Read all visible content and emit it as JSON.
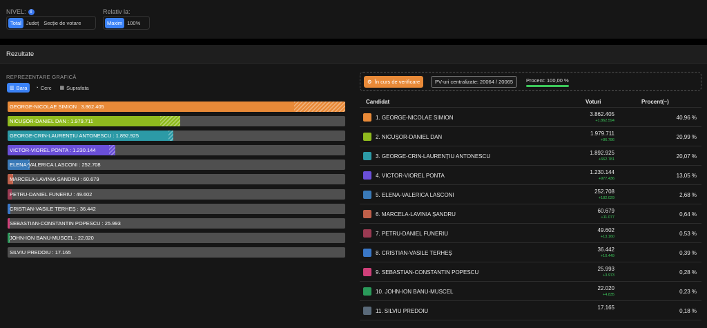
{
  "filters": {
    "nivel_label": "NIVEL:",
    "nivel_options": [
      "Total",
      "Județ",
      "Secție de votare"
    ],
    "nivel_active": 0,
    "relativ_label": "Relativ la:",
    "relativ_options": [
      "Maxim",
      "100%"
    ],
    "relativ_active": 0
  },
  "results_title": "Rezultate",
  "grafica": {
    "label": "REPREZENTARE GRAFICĂ",
    "tabs": [
      "Bara",
      "Cerc",
      "Suprafata"
    ],
    "active": 0
  },
  "status": {
    "verification": "În curs de verificare",
    "pv_text": "PV-uri centralizate: 20064 / 20065",
    "procent_text": "Procent: 100,00 %",
    "procent_value": 100
  },
  "table_headers": {
    "candidat": "Candidat",
    "voturi": "Voturi",
    "procent": "Procent(~)"
  },
  "candidates": [
    {
      "num": "1.",
      "name": "GEORGE-NICOLAE SIMION",
      "bar_label": "GEORGE-NICOLAE SIMION : 3.862.405",
      "votes": "3.862.405",
      "delta": "+1.862.594",
      "pct": "40,96 %",
      "color": "#e98a38",
      "bar_value": 1.0,
      "hatch_from": 0.848
    },
    {
      "num": "2.",
      "name": "NICUȘOR-DANIEL DAN",
      "bar_label": "NICUȘOR-DANIEL DAN : 1.979.711",
      "votes": "1.979.711",
      "delta": "+86.786",
      "pct": "20,99 %",
      "color": "#8fba1e",
      "bar_value": 0.512,
      "hatch_from": 0.451
    },
    {
      "num": "3.",
      "name": "GEORGE-CRIN-LAURENȚIU ANTONESCU",
      "bar_label": "GEORGE-CRIN-LAURENȚIU ANTONESCU : 1.892.925",
      "votes": "1.892.925",
      "delta": "+662.781",
      "pct": "20,07 %",
      "color": "#2c9aa6",
      "bar_value": 0.49,
      "hatch_from": 0.476
    },
    {
      "num": "4.",
      "name": "VICTOR-VIOREL PONTA",
      "bar_label": "VICTOR-VIOREL PONTA : 1.230.144",
      "votes": "1.230.144",
      "delta": "+977.436",
      "pct": "13,05 %",
      "color": "#6a4fd8",
      "bar_value": 0.318,
      "hatch_from": 0.301
    },
    {
      "num": "5.",
      "name": "ELENA-VALERICA LASCONI",
      "bar_label": "ELENA-VALERICA LASCONI : 252.708",
      "votes": "252.708",
      "delta": "+182.029",
      "pct": "2,68 %",
      "color": "#3a7ab8",
      "bar_value": 0.065,
      "hatch_from": 0.061
    },
    {
      "num": "6.",
      "name": "MARCELA-LAVINIA ȘANDRU",
      "bar_label": "MARCELA-LAVINIA ȘANDRU : 60.679",
      "votes": "60.679",
      "delta": "+11.077",
      "pct": "0,64 %",
      "color": "#c0604a",
      "bar_value": 0.016,
      "hatch_from": 0.014
    },
    {
      "num": "7.",
      "name": "PETRU-DANIEL FUNERIU",
      "bar_label": "PETRU-DANIEL FUNERIU : 49.602",
      "votes": "49.602",
      "delta": "+13.160",
      "pct": "0,53 %",
      "color": "#9a3a52",
      "bar_value": 0.013,
      "hatch_from": 0.012
    },
    {
      "num": "8.",
      "name": "CRISTIAN-VASILE TERHEȘ",
      "bar_label": "CRISTIAN-VASILE TERHEȘ : 36.442",
      "votes": "36.442",
      "delta": "+10.449",
      "pct": "0,39 %",
      "color": "#3a78c8",
      "bar_value": 0.009,
      "hatch_from": 0.008
    },
    {
      "num": "9.",
      "name": "SEBASTIAN-CONSTANTIN POPESCU",
      "bar_label": "SEBASTIAN-CONSTANTIN POPESCU : 25.993",
      "votes": "25.993",
      "delta": "+3.973",
      "pct": "0,28 %",
      "color": "#d0407a",
      "bar_value": 0.007,
      "hatch_from": 0.006
    },
    {
      "num": "10.",
      "name": "JOHN-ION BANU-MUSCEL",
      "bar_label": "JOHN-ION BANU-MUSCEL : 22.020",
      "votes": "22.020",
      "delta": "+4.835",
      "pct": "0,23 %",
      "color": "#2a9a5a",
      "bar_value": 0.006,
      "hatch_from": 0.005
    },
    {
      "num": "11.",
      "name": "SILVIU PREDOIU",
      "bar_label": "SILVIU PREDOIU : 17.165",
      "votes": "17.165",
      "delta": "",
      "pct": "0,18 %",
      "color": "#5a6a7a",
      "bar_value": 0.0,
      "hatch_from": 0.0
    }
  ]
}
